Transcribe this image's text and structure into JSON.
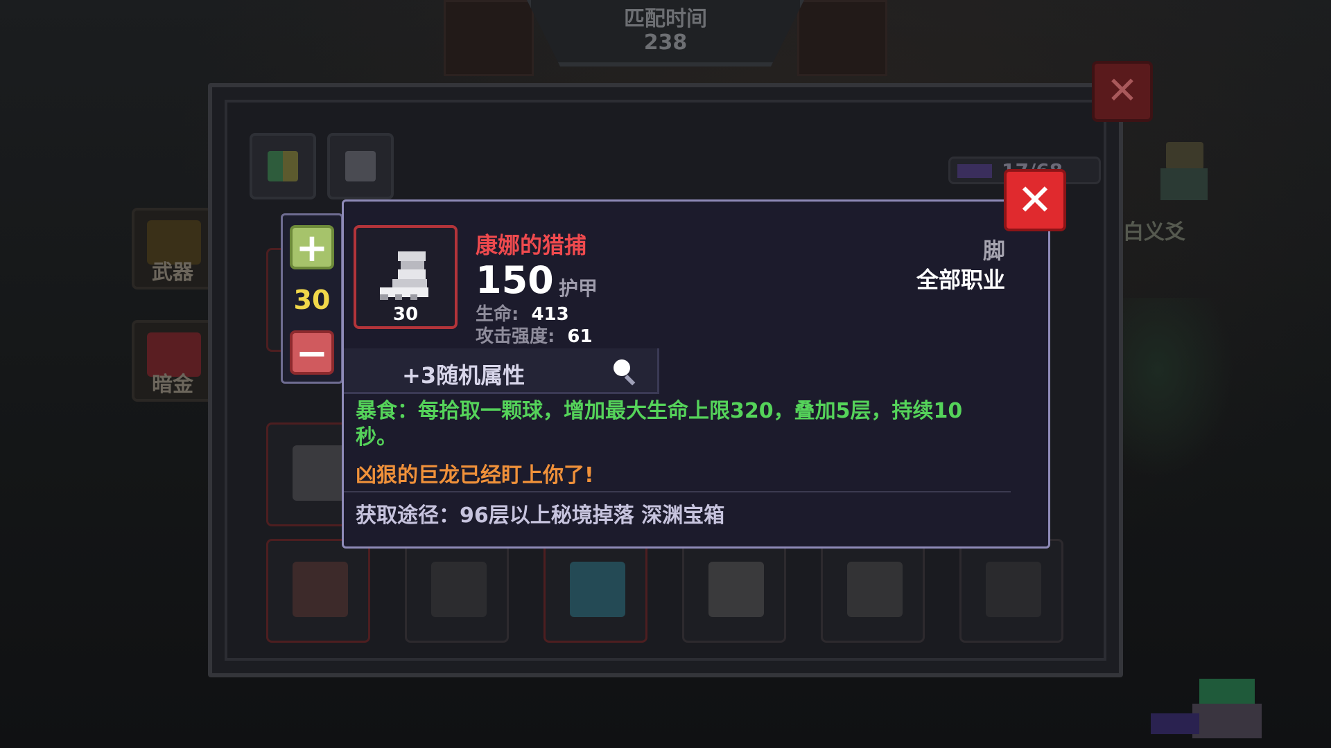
{
  "match": {
    "label": "匹配时间",
    "value": "238"
  },
  "side_left": [
    {
      "label": "武器",
      "icon": "weapon-icon",
      "color": "#3a3018"
    },
    {
      "label": "暗金",
      "icon": "ring-icon",
      "color": "#5a1e22"
    }
  ],
  "side_right": {
    "name": "白义爻"
  },
  "inventory": {
    "count": "17/68",
    "tabs": [
      "grid-tab-icon",
      "helmet-tab-icon"
    ]
  },
  "stepper": {
    "value": "30",
    "plus": "+",
    "minus": "−"
  },
  "tooltip": {
    "item_name": "康娜的猎捕",
    "item_level": "30",
    "armor_value": "150",
    "armor_label": "护甲",
    "stats": [
      {
        "label": "生命:",
        "value": "413"
      },
      {
        "label": "攻击强度:",
        "value": "61"
      }
    ],
    "slot": "脚",
    "class": "全部职业",
    "random_attr": "+3随机属性",
    "effect": "暴食：每拾取一颗球，增加最大生命上限320，叠加5层，持续10秒。",
    "flavor": "凶狠的巨龙已经盯上你了!",
    "source": "获取途径：96层以上秘境掉落 深渊宝箱",
    "close": "✕"
  },
  "close_outer": "✕",
  "colors": {
    "item_name": "#ef4a4e",
    "effect": "#55d35a",
    "flavor": "#f0913a",
    "accent_border": "#8e8ab8"
  }
}
